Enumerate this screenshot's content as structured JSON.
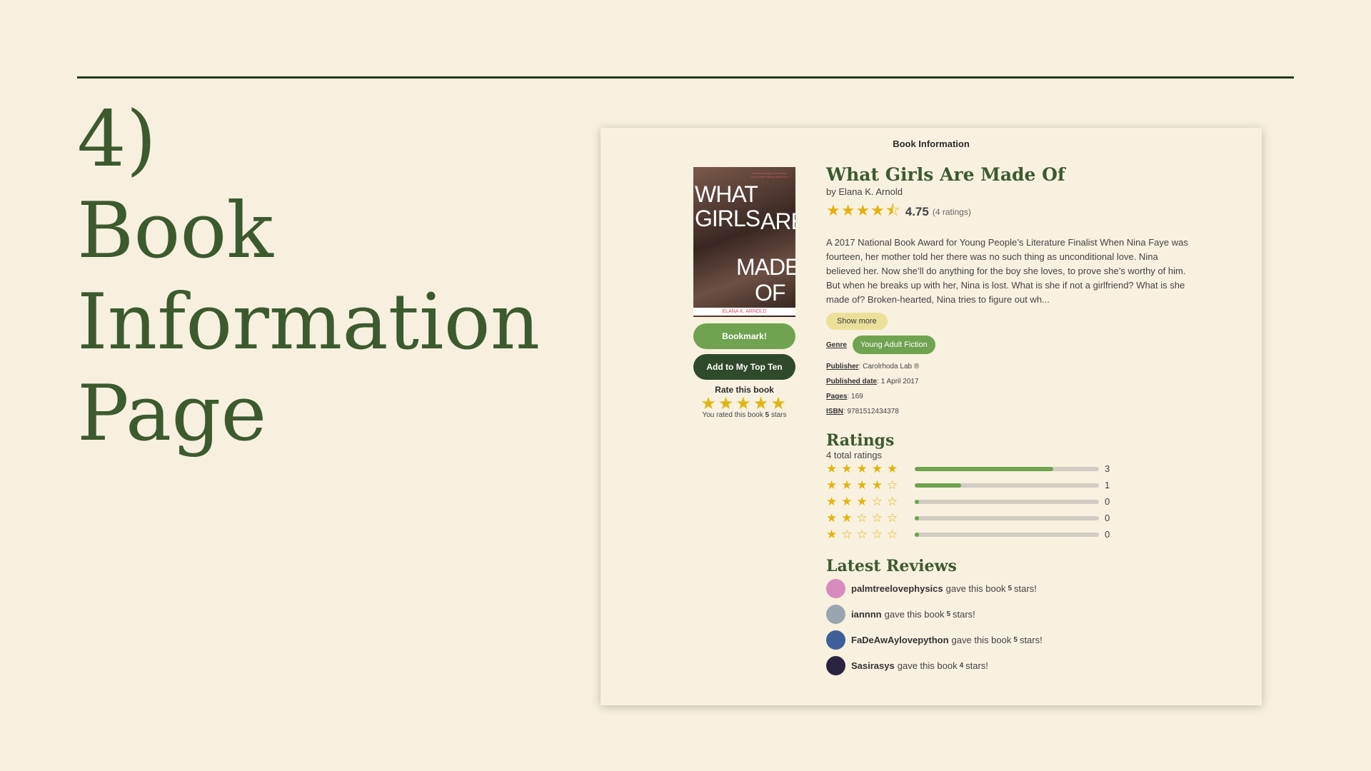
{
  "slide": {
    "title_lines": [
      "4)",
      "Book",
      "Information",
      "Page"
    ]
  },
  "card": {
    "header": "Book Information"
  },
  "book": {
    "title": "What Girls Are Made Of",
    "author": "by Elana K. Arnold",
    "average_rating": "4.75",
    "ratings_count": "(4 ratings)",
    "average_stars": "★★★★⯪",
    "description": "A 2017 National Book Award for Young People’s Literature Finalist When Nina Faye was fourteen, her mother told her there was no such thing as unconditional love. Nina believed her. Now she’ll do anything for the boy she loves, to prove she’s worthy of him. But when he breaks up with her, Nina is lost. What is she if not a girlfriend? What is she made of? Broken-hearted, Nina tries to figure out wh...",
    "show_more_label": "Show more",
    "genre_label": "Genre",
    "genre": "Young Adult Fiction",
    "publisher_label": "Publisher",
    "publisher": "Carolrhoda Lab ®",
    "published_date_label": "Published date",
    "published_date": "1 April 2017",
    "pages_label": "Pages",
    "pages": "169",
    "isbn_label": "ISBN",
    "isbn": "9781512434378",
    "cover": {
      "title_words": [
        "WHAT",
        "GIRLS",
        "ARE",
        "MADE",
        "OF"
      ],
      "author": "ELANA K. ARNOLD"
    }
  },
  "actions": {
    "bookmark_label": "Bookmark!",
    "top_ten_label": "Add to My Top Ten",
    "rate_label": "Rate this book",
    "rate_stars": "★★★★★",
    "rated_prefix": "You rated this book",
    "rated_value": "5",
    "rated_suffix": "stars"
  },
  "ratings": {
    "title": "Ratings",
    "total": "4 total ratings",
    "distribution": [
      {
        "stars": "★★★★★",
        "count": "3",
        "fraction": 0.75
      },
      {
        "stars": "★★★★☆",
        "count": "1",
        "fraction": 0.25
      },
      {
        "stars": "★★★☆☆",
        "count": "0",
        "fraction": 0.0
      },
      {
        "stars": "★★☆☆☆",
        "count": "0",
        "fraction": 0.0
      },
      {
        "stars": "★☆☆☆☆",
        "count": "0",
        "fraction": 0.0
      }
    ]
  },
  "reviews": {
    "title": "Latest Reviews",
    "items": [
      {
        "user": "palmtreelovephysics",
        "pre": "gave this book",
        "rating": "5",
        "post": "stars!",
        "avatar_color": "#d98bc0"
      },
      {
        "user": "iannnn",
        "pre": "gave this book",
        "rating": "5",
        "post": "stars!",
        "avatar_color": "#9aa5b0"
      },
      {
        "user": "FaDeAwAylovepython",
        "pre": "gave this book",
        "rating": "5",
        "post": "stars!",
        "avatar_color": "#3e5f9a"
      },
      {
        "user": "Sasirasys",
        "pre": "gave this book",
        "rating": "4",
        "post": "stars!",
        "avatar_color": "#2a2340"
      }
    ]
  },
  "colors": {
    "background": "#f7f0de",
    "heading_green": "#3d5a2f",
    "accent_green": "#6fa34f",
    "dark_green": "#2f4a2a",
    "star_gold": "#e1b40f",
    "show_more_bg": "#ebe09a"
  }
}
